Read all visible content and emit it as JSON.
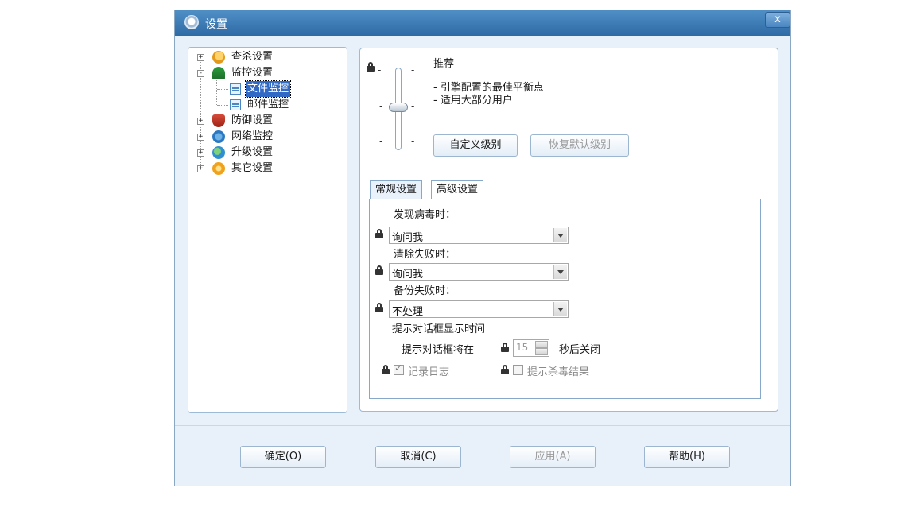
{
  "window": {
    "title": "设置",
    "close_label": "x"
  },
  "tree": {
    "items": [
      {
        "label": "查杀设置",
        "expander": "+"
      },
      {
        "label": "监控设置",
        "expander": "-"
      },
      {
        "label": "文件监控"
      },
      {
        "label": "邮件监控"
      },
      {
        "label": "防御设置",
        "expander": "+"
      },
      {
        "label": "网络监控",
        "expander": "+"
      },
      {
        "label": "升级设置",
        "expander": "+"
      },
      {
        "label": "其它设置",
        "expander": "+"
      }
    ]
  },
  "level": {
    "title": "推荐",
    "desc1": "- 引擎配置的最佳平衡点",
    "desc2": "- 适用大部分用户",
    "custom_button": "自定义级别",
    "restore_button": "恢复默认级别",
    "tick": "-"
  },
  "tabs": [
    {
      "label": "常规设置"
    },
    {
      "label": "高级设置"
    }
  ],
  "general": {
    "virus_found_label": "发现病毒时：",
    "virus_found_value": "询问我",
    "clean_fail_label": "清除失败时：",
    "clean_fail_value": "询问我",
    "backup_fail_label": "备份失败时：",
    "backup_fail_value": "不处理",
    "dialog_time_label": "提示对话框显示时间",
    "dialog_prefix": "提示对话框将在",
    "dialog_seconds": "15",
    "dialog_suffix": "秒后关闭",
    "log_label": "记录日志",
    "result_label": "提示杀毒结果"
  },
  "buttons": {
    "ok": "确定(O)",
    "cancel": "取消(C)",
    "apply": "应用(A)",
    "help": "帮助(H)"
  }
}
